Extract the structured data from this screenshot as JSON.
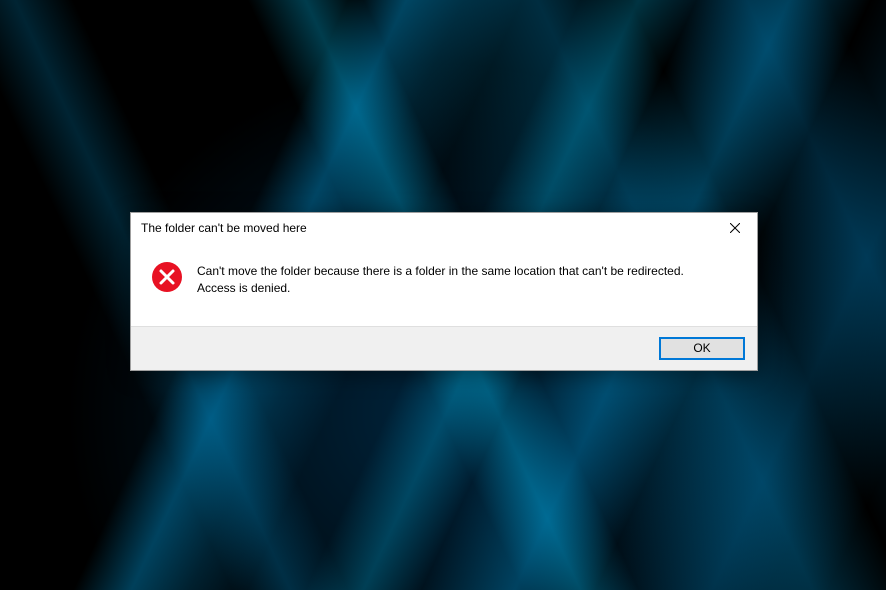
{
  "dialog": {
    "title": "The folder can't be moved here",
    "message_line1": "Can't move the folder because there is a folder in the same location that can't be redirected.",
    "message_line2": "Access is denied.",
    "ok_label": "OK",
    "icon": "error-icon"
  }
}
